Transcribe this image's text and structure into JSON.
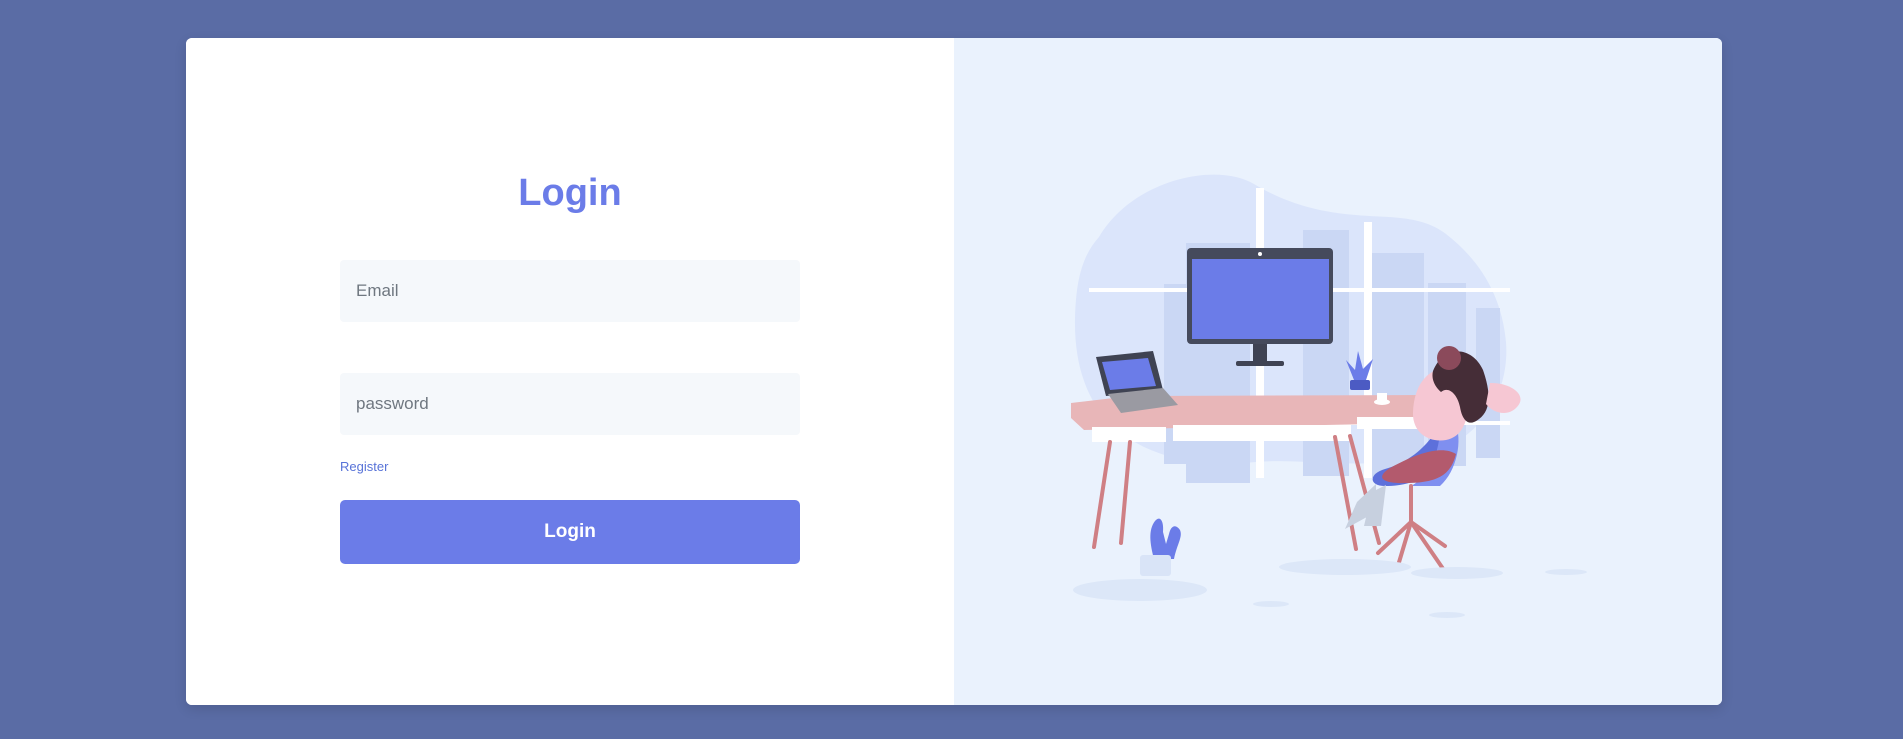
{
  "login_form": {
    "title": "Login",
    "email": {
      "value": "",
      "placeholder": "Email"
    },
    "password": {
      "value": "",
      "placeholder": "password"
    },
    "register_link": "Register",
    "submit_label": "Login"
  },
  "illustration": {
    "subject": "woman-at-desk-illustration"
  },
  "colors": {
    "page_background": "#5a6ca5",
    "card_background": "#ffffff",
    "illustration_background": "#eaf2fd",
    "accent": "#6b7ce8",
    "field_background": "#f5f8fb",
    "link": "#5873d8"
  }
}
